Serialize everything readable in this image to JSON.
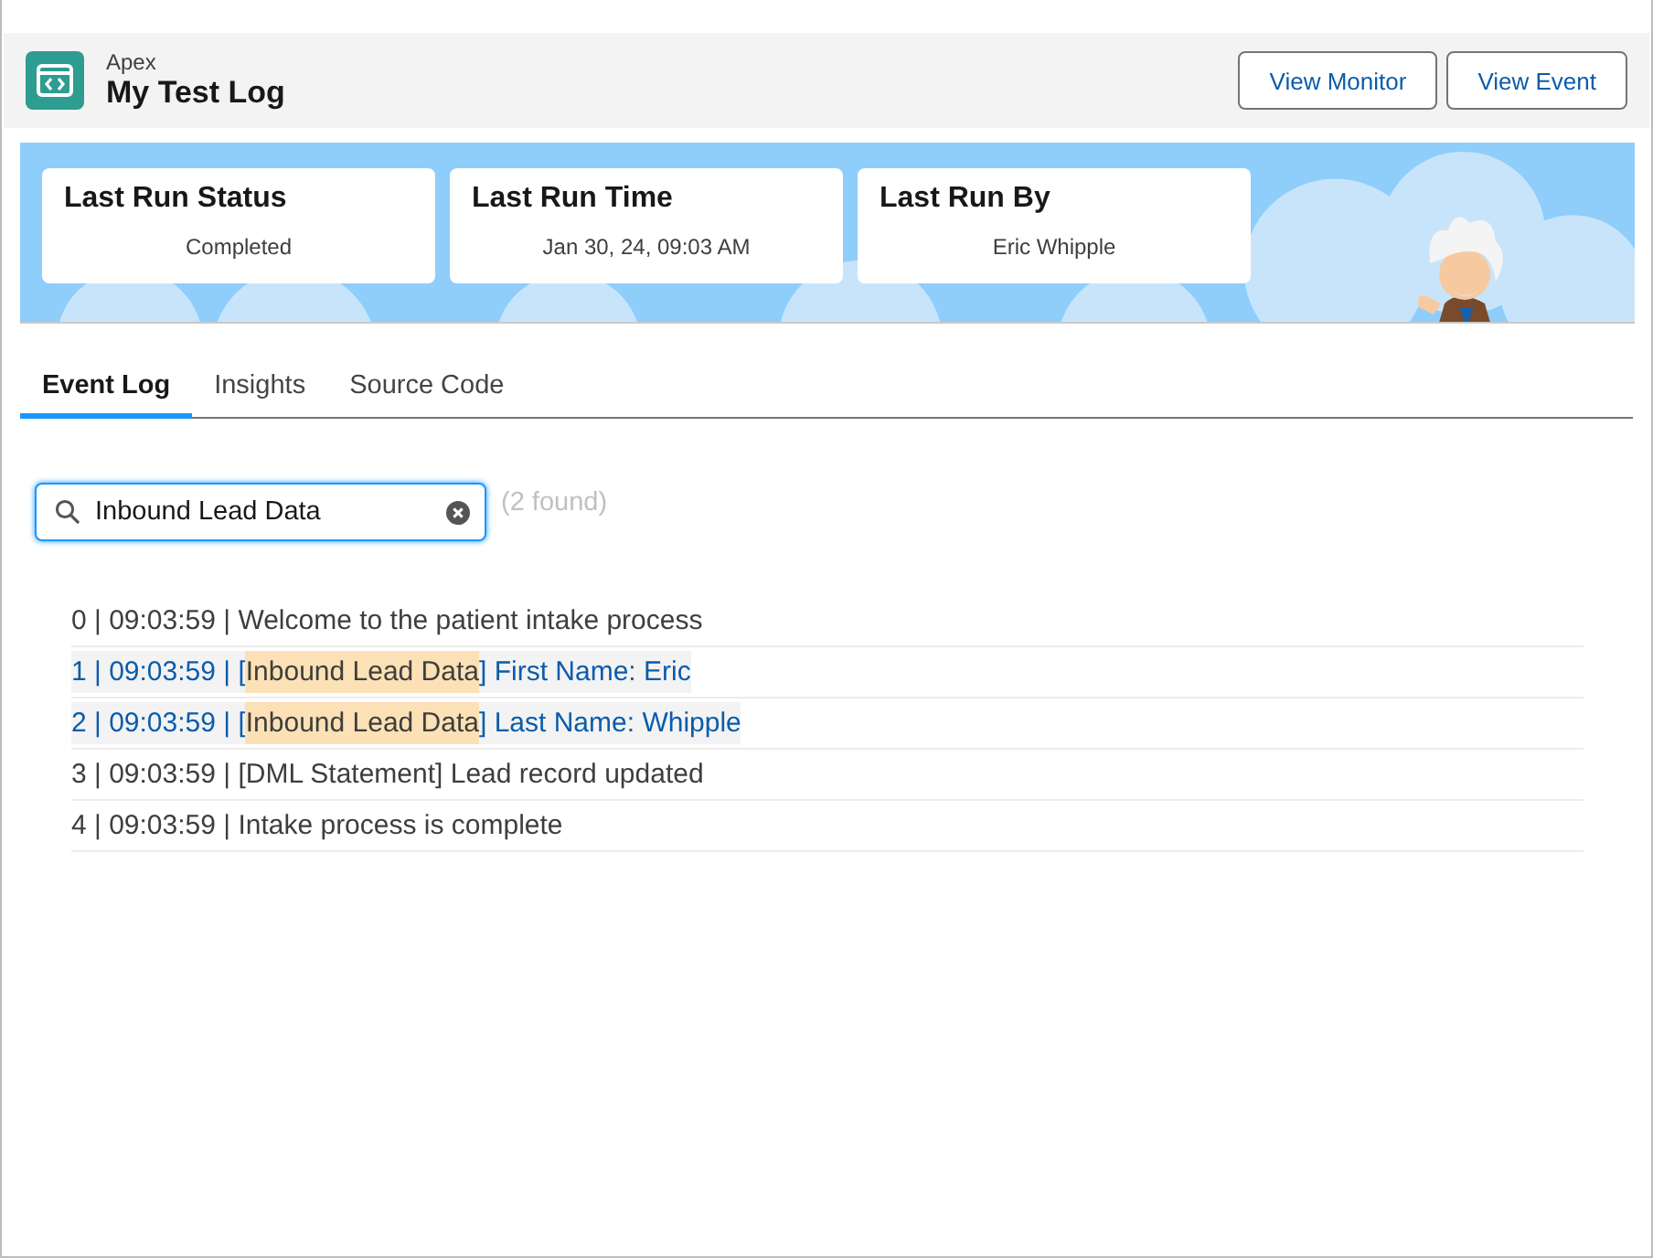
{
  "header": {
    "object_type": "Apex",
    "title": "My Test Log",
    "buttons": [
      "View Monitor",
      "View Event"
    ]
  },
  "stats": [
    {
      "label": "Last Run Status",
      "value": "Completed"
    },
    {
      "label": "Last Run Time",
      "value": "Jan 30, 24, 09:03 AM"
    },
    {
      "label": "Last Run By",
      "value": "Eric Whipple"
    }
  ],
  "tabs": [
    {
      "label": "Event Log",
      "selected": true
    },
    {
      "label": "Insights",
      "selected": false
    },
    {
      "label": "Source Code",
      "selected": false
    }
  ],
  "search": {
    "value": "Inbound Lead Data",
    "result_count": "(2 found)"
  },
  "log_rows": [
    {
      "matched": false,
      "parts": [
        {
          "text": "0 | 09:03:59 | Welcome to the patient intake process",
          "hit": false
        }
      ]
    },
    {
      "matched": true,
      "parts": [
        {
          "text": "1 | 09:03:59 | [",
          "hit": false
        },
        {
          "text": "Inbound Lead Data",
          "hit": true
        },
        {
          "text": "] First Name: Eric",
          "hit": false
        }
      ]
    },
    {
      "matched": true,
      "parts": [
        {
          "text": "2 | 09:03:59 | [",
          "hit": false
        },
        {
          "text": "Inbound Lead Data",
          "hit": true
        },
        {
          "text": "] Last Name: Whipple",
          "hit": false
        }
      ]
    },
    {
      "matched": false,
      "parts": [
        {
          "text": "3 | 09:03:59 | [DML Statement] Lead record updated",
          "hit": false
        }
      ]
    },
    {
      "matched": false,
      "parts": [
        {
          "text": "4 | 09:03:59 | Intake process is complete",
          "hit": false
        }
      ]
    }
  ]
}
